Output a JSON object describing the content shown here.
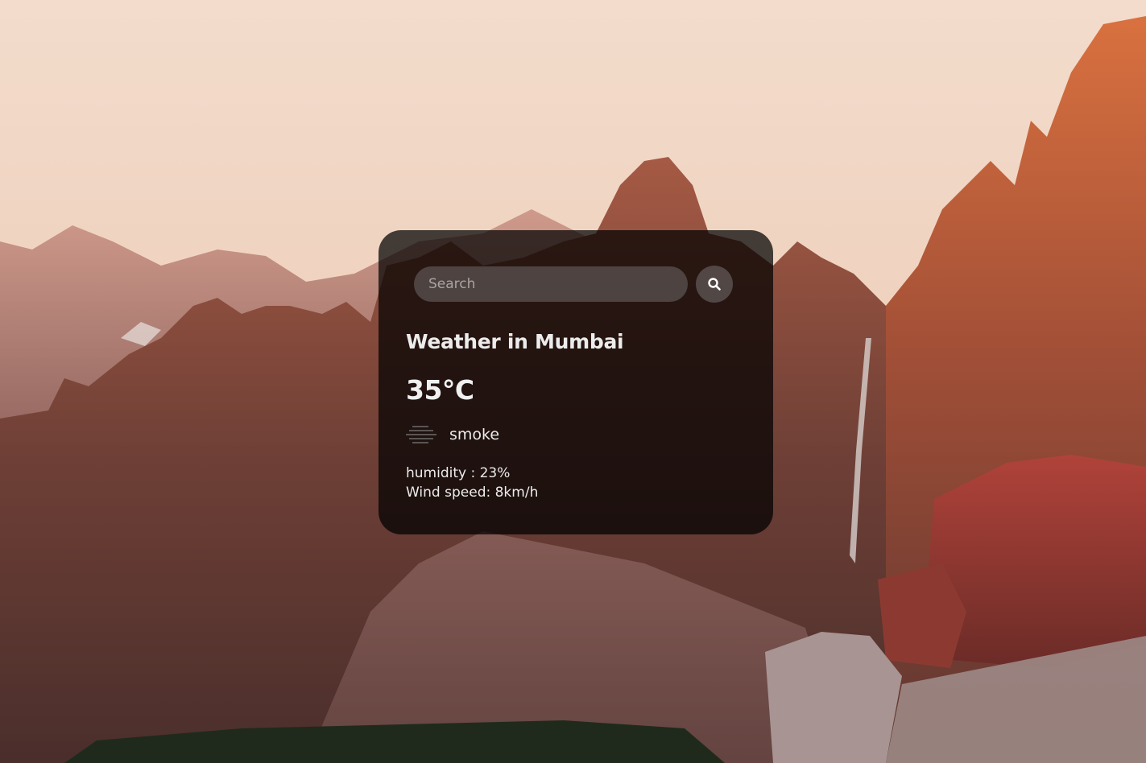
{
  "search": {
    "placeholder": "Search",
    "button_icon": "search-icon"
  },
  "weather": {
    "city_title": "Weather in Mumbai",
    "temperature": "35°C",
    "condition_icon": "smoke-icon",
    "description": "smoke",
    "humidity": "humidity : 23%",
    "wind": "Wind speed: 8km/h"
  },
  "colors": {
    "card_background": "#000000",
    "text": "#ececec",
    "search_field": "#6e6969"
  },
  "background": {
    "icon": "mountain-landscape-photo"
  }
}
